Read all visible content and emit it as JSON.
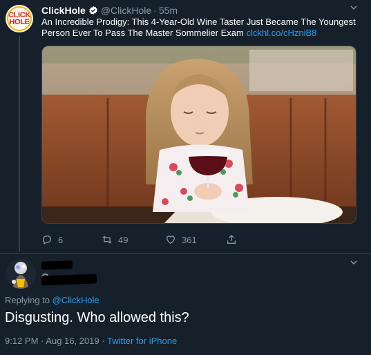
{
  "tweet": {
    "author_name": "ClickHole",
    "handle": "@ClickHole",
    "separator": "·",
    "time": "55m",
    "text": "An Incredible Prodigy: This 4-Year-Old Wine Taster Just Became The Youngest Person Ever To Pass The Master Sommelier Exam",
    "link": "clckhl.co/cHzniB8",
    "avatar_text_top": "CLICK",
    "avatar_text_bottom": "HOLE",
    "replies": "6",
    "retweets": "49",
    "likes": "361"
  },
  "reply": {
    "replying_prefix": "Replying to",
    "replying_to": "@ClickHole",
    "text": "Disgusting. Who allowed this?",
    "time": "9:12 PM",
    "date": "Aug 16, 2019",
    "source": "Twitter for iPhone",
    "separator": "·"
  },
  "colors": {
    "background": "#15202b",
    "accent": "#1da1f2",
    "muted": "#8899a6"
  }
}
